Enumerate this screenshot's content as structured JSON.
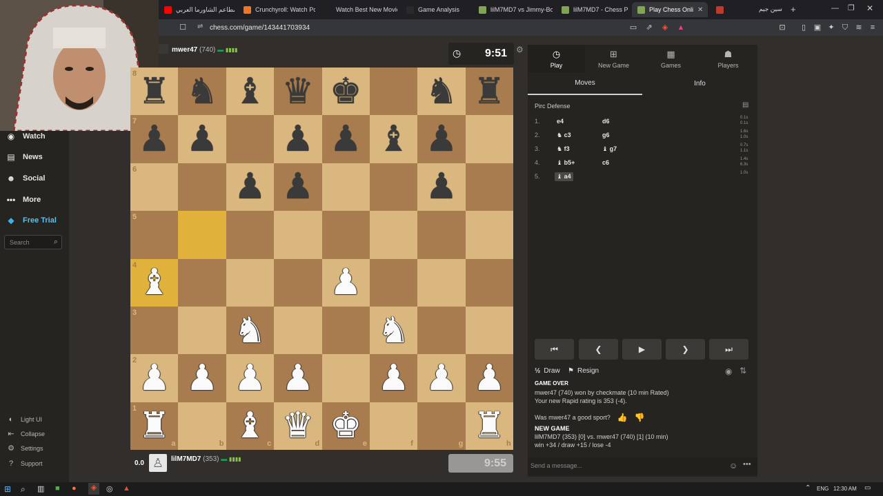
{
  "browser": {
    "tabs": [
      {
        "label": "مطاعم الشاورما العربي",
        "fav": "#ff0000"
      },
      {
        "label": "Crunchyroll: Watch Po",
        "fav": "#f47521"
      },
      {
        "label": "Watch Best New Movie",
        "fav": "#202020"
      },
      {
        "label": "Game Analysis",
        "fav": "#2a2a2a"
      },
      {
        "label": "lilM7MD7 vs Jimmy-Bo",
        "fav": "#7fa650"
      },
      {
        "label": "lilM7MD7 - Chess Prof",
        "fav": "#7fa650"
      },
      {
        "label": "Play Chess Onli",
        "fav": "#7fa650",
        "active": true
      },
      {
        "label": "",
        "fav": "#c0392b"
      }
    ],
    "right_label": "سين جيم",
    "url": "chess.com/game/143441703934"
  },
  "sidebar": {
    "items": [
      {
        "label": "Watch",
        "icon": "binoculars-icon",
        "glyph": "◉"
      },
      {
        "label": "News",
        "icon": "news-icon",
        "glyph": "▤"
      },
      {
        "label": "Social",
        "icon": "social-icon",
        "glyph": "☻"
      },
      {
        "label": "More",
        "icon": "more-icon",
        "glyph": "•••"
      },
      {
        "label": "Free Trial",
        "icon": "diamond-icon",
        "glyph": "◆"
      }
    ],
    "search_placeholder": "Search",
    "footer": [
      {
        "label": "Light UI",
        "icon": "light-ui-icon",
        "glyph": "◐"
      },
      {
        "label": "Collapse",
        "icon": "collapse-icon",
        "glyph": "⇤"
      },
      {
        "label": "Settings",
        "icon": "settings-icon",
        "glyph": "⚙"
      },
      {
        "label": "Support",
        "icon": "support-icon",
        "glyph": "?"
      }
    ]
  },
  "top_player": {
    "name": "mwer47",
    "rating": "(740)",
    "clock": "9:51"
  },
  "bottom_player": {
    "name": "lilM7MD7",
    "rating": "(353)",
    "clock": "9:55",
    "eval": "0.0"
  },
  "board": {
    "light": "#d9b77e",
    "dark": "#a87c4f",
    "highlight": "#e0b13b",
    "files": [
      "a",
      "b",
      "c",
      "d",
      "e",
      "f",
      "g",
      "h"
    ],
    "ranks": [
      "8",
      "7",
      "6",
      "5",
      "4",
      "3",
      "2",
      "1"
    ],
    "pieces": [
      "rnbqk.nr",
      "pp.ppbp.",
      "..pp..p.",
      "........",
      "B...P...",
      "..N..N..",
      "PPPP.PPP",
      "R.BQK..R"
    ],
    "highlight_squares": [
      "b5",
      "a4"
    ]
  },
  "panel": {
    "top_tabs": [
      {
        "label": "Play",
        "icon": "play-clock-icon",
        "glyph": "◷",
        "active": true
      },
      {
        "label": "New Game",
        "icon": "new-game-icon",
        "glyph": "⊞"
      },
      {
        "label": "Games",
        "icon": "games-icon",
        "glyph": "▦"
      },
      {
        "label": "Players",
        "icon": "players-icon",
        "glyph": "☗"
      }
    ],
    "sub_tabs": [
      "Moves",
      "Info"
    ],
    "opening": "Pirc Defense",
    "moves": [
      {
        "num": "1.",
        "w": "e4",
        "b": "d6",
        "t": [
          "0.1s",
          "0.1s"
        ]
      },
      {
        "num": "2.",
        "w": "♞ c3",
        "b": "g6",
        "t": [
          "1.6s",
          "1.0s"
        ]
      },
      {
        "num": "3.",
        "w": "♞ f3",
        "b": "♝ g7",
        "t": [
          "0.7s",
          "1.1s"
        ]
      },
      {
        "num": "4.",
        "w": "♝ b5+",
        "b": "c6",
        "t": [
          "1.4s",
          "6.3s"
        ]
      },
      {
        "num": "5.",
        "w": "♝ a4",
        "b": "",
        "t": [
          "1.0s",
          ""
        ]
      }
    ],
    "draw_label": "Draw",
    "resign_label": "Resign",
    "log": {
      "game_over": "GAME OVER",
      "result": "mwer47 (740) won by checkmate (10 min Rated)",
      "rating": "Your new Rapid rating is 353 (-4).",
      "sport_q": "Was mwer47 a good sport?",
      "new_game": "NEW GAME",
      "matchup": "lilM7MD7 (353) [0] vs. mwer47 (740) [1] (10 min)",
      "odds": "win +34 / draw +15 / lose -4"
    },
    "chat_placeholder": "Send a message..."
  },
  "taskbar": {
    "lang": "ENG",
    "time": "12:30 AM"
  }
}
